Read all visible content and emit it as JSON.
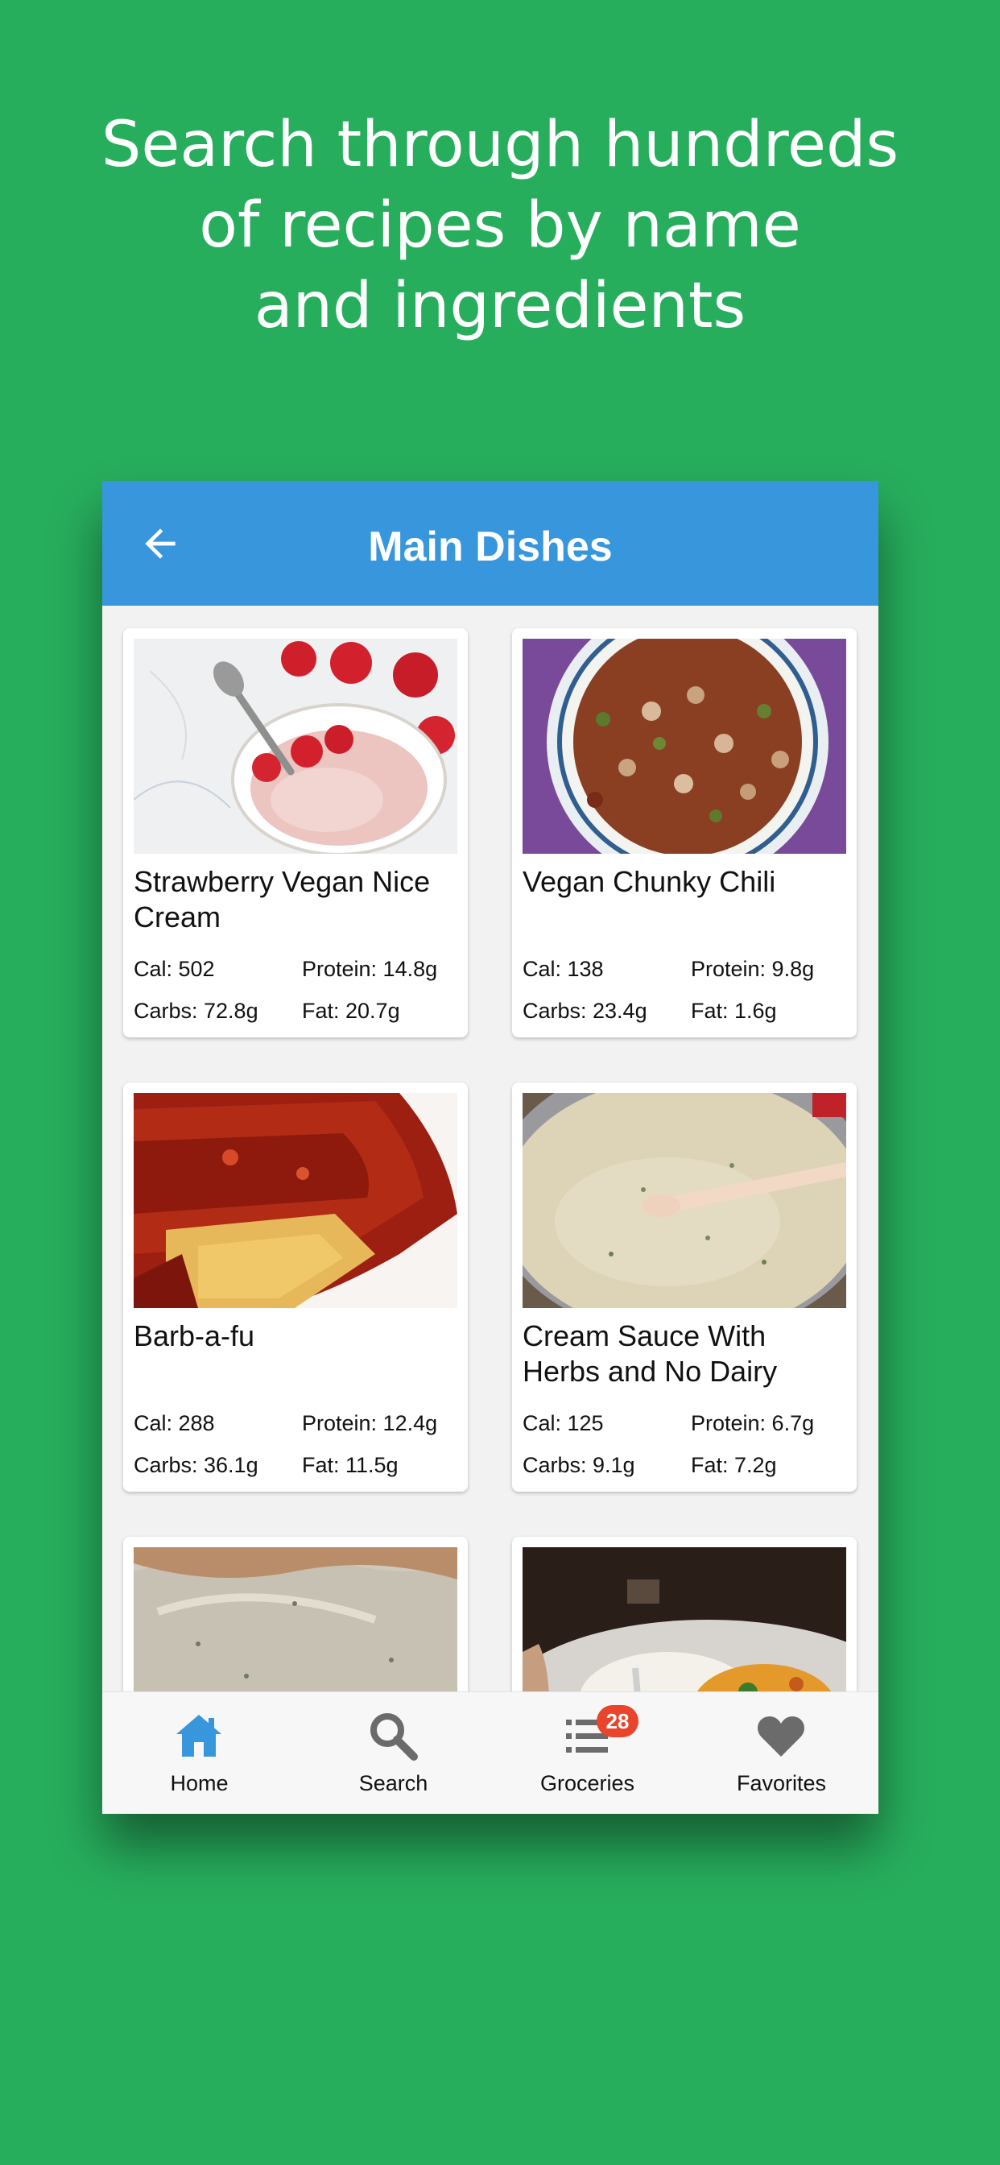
{
  "headline": {
    "line1": "Search through hundreds",
    "line2": "of recipes by name",
    "line3": "and ingredients"
  },
  "appbar": {
    "title": "Main Dishes",
    "back_icon": "arrow-left-icon"
  },
  "recipes": [
    {
      "title": "Strawberry Vegan Nice Cream",
      "cal": "Cal: 502",
      "protein": "Protein: 14.8g",
      "carbs": "Carbs: 72.8g",
      "fat": "Fat: 20.7g"
    },
    {
      "title": "Vegan Chunky Chili",
      "cal": "Cal: 138",
      "protein": "Protein: 9.8g",
      "carbs": "Carbs: 23.4g",
      "fat": "Fat: 1.6g"
    },
    {
      "title": "Barb-a-fu",
      "cal": "Cal: 288",
      "protein": "Protein: 12.4g",
      "carbs": "Carbs: 36.1g",
      "fat": "Fat: 11.5g"
    },
    {
      "title": "Cream Sauce With Herbs and No Dairy",
      "cal": "Cal: 125",
      "protein": "Protein: 6.7g",
      "carbs": "Carbs: 9.1g",
      "fat": "Fat: 7.2g"
    }
  ],
  "bottom_nav": {
    "items": [
      {
        "label": "Home",
        "icon": "home-icon",
        "active": true
      },
      {
        "label": "Search",
        "icon": "search-icon",
        "active": false
      },
      {
        "label": "Groceries",
        "icon": "list-icon",
        "active": false,
        "badge": "28"
      },
      {
        "label": "Favorites",
        "icon": "heart-icon",
        "active": false
      }
    ]
  },
  "colors": {
    "background": "#27ae5d",
    "appbar": "#3796dc",
    "nav_active": "#3796dc",
    "nav_inactive": "#6b6b6b",
    "badge": "#e8452c"
  }
}
